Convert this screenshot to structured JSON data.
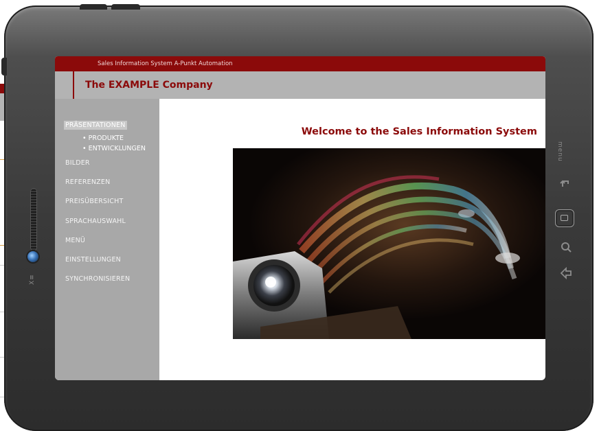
{
  "app": {
    "system_title": "Sales Information System A-Punkt Automation",
    "company_name": "The EXAMPLE Company",
    "welcome_heading": "Welcome to the Sales Information System"
  },
  "sidebar": {
    "items": [
      {
        "label": "PRÄSENTATIONEN",
        "active": true
      },
      {
        "label": "BILDER"
      },
      {
        "label": "REFERENZEN"
      },
      {
        "label": "PREISÜBERSICHT"
      },
      {
        "label": "SPRACHAUSWAHL"
      },
      {
        "label": "MENÜ"
      },
      {
        "label": "EINSTELLUNGEN"
      },
      {
        "label": "SYNCHRONISIEREN"
      }
    ],
    "sub_items": [
      {
        "label": "• PRODUKTE"
      },
      {
        "label": "• ENTWICKLUNGEN"
      }
    ]
  },
  "device": {
    "brand_label": "X≡",
    "menu_label": "menu"
  },
  "colors": {
    "accent": "#8b0a0a",
    "header_gray": "#b3b3b3",
    "sidebar_gray": "#a8a8a8",
    "bezel": "#3a3a3a"
  },
  "icons": {
    "back": "back-arrow-icon",
    "home": "home-button-icon",
    "search": "search-icon",
    "nav_back": "nav-back-icon"
  }
}
